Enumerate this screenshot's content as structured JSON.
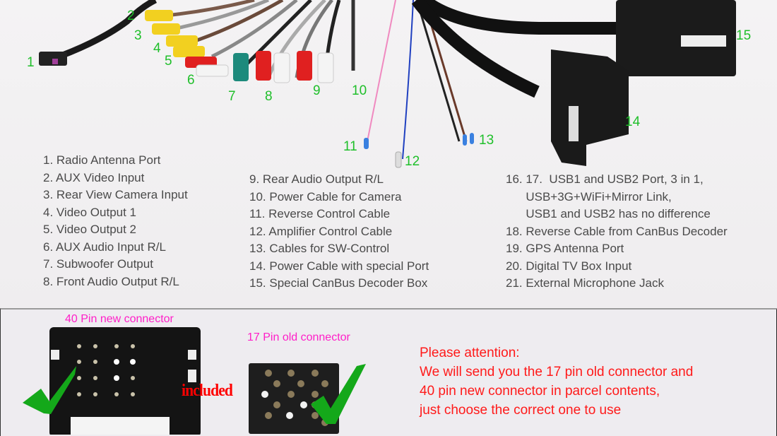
{
  "diagram_labels": [
    "1",
    "2",
    "3",
    "4",
    "5",
    "6",
    "7",
    "8",
    "9",
    "10",
    "11",
    "12",
    "13",
    "14",
    "15"
  ],
  "legend": {
    "column1": [
      "1. Radio Antenna Port",
      "2. AUX Video Input",
      "3. Rear View Camera Input",
      "4. Video Output 1",
      "5. Video Output 2",
      "6. AUX Audio Input R/L",
      "7. Subwoofer Output",
      "8. Front Audio Output R/L"
    ],
    "column2": [
      "9. Rear Audio Output R/L",
      "10. Power Cable for Camera",
      "11. Reverse Control Cable",
      "12. Amplifier Control Cable",
      "13. Cables for SW-Control",
      "14. Power Cable with special Port",
      "15. Special CanBus Decoder Box"
    ],
    "column3": [
      "16. 17.  USB1 and USB2 Port, 3 in 1,",
      "      USB+3G+WiFi+Mirror Link,",
      "      USB1 and USB2 has no difference",
      "18. Reverse Cable from CanBus Decoder",
      "19. GPS Antenna Port",
      "20. Digital TV Box Input",
      "21. External Microphone Jack"
    ]
  },
  "connectors": {
    "new_title": "40 Pin new connector",
    "old_title": "17 Pin old connector",
    "included": "included"
  },
  "attention": {
    "lines": [
      "Please attention:",
      "We will send you the 17 pin old connector and",
      "40 pin new connector in parcel contents,",
      "just choose the correct one to use"
    ]
  },
  "colors": {
    "label_green": "#1fbf2a",
    "title_pink": "#ff1fc8",
    "alert_red": "#ff1a1a"
  }
}
